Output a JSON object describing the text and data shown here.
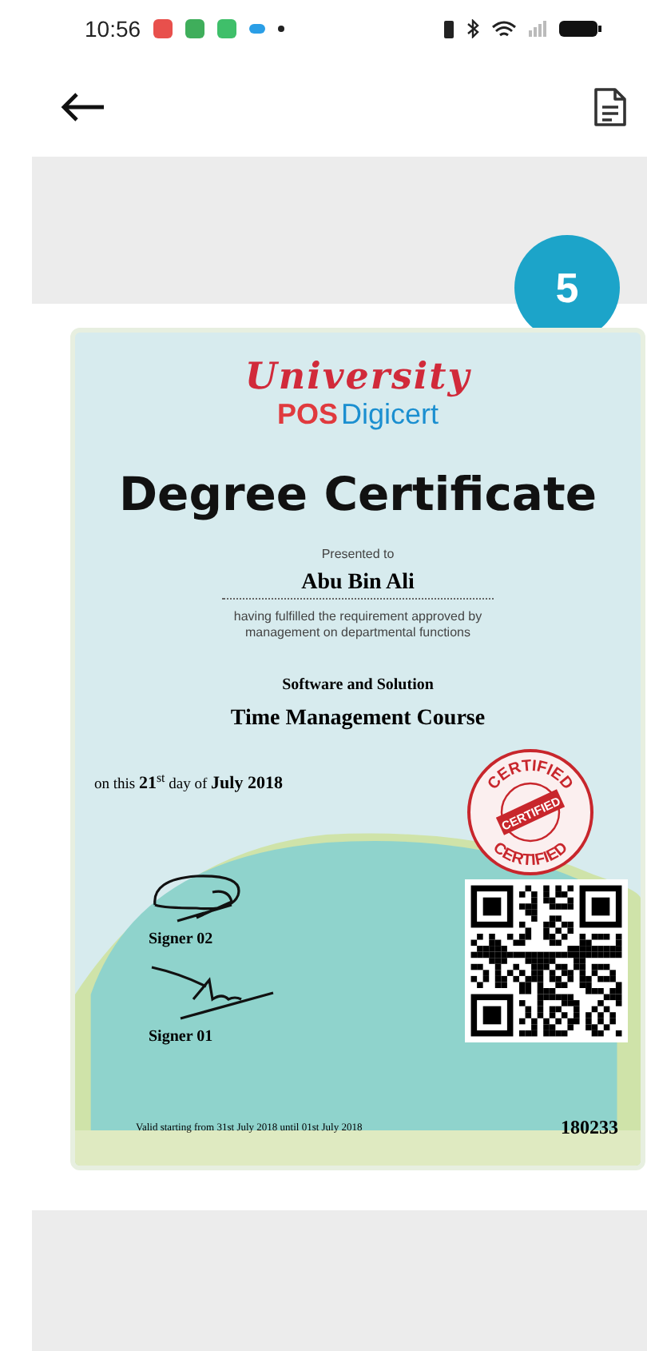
{
  "status_bar": {
    "time": "10:56"
  },
  "certificate": {
    "badge": "5",
    "university": "University",
    "logo_brand": "POS",
    "logo_name": "Digicert",
    "title": "Degree Certificate",
    "presented": "Presented to",
    "recipient": "Abu Bin Ali",
    "statement": "having fulfilled the requirement approved by management on departmental functions",
    "department": "Software and Solution",
    "course": "Time Management Course",
    "date": "on this **21**$^{st}$ day of **July 2018**",
    "stamp": {
      "ring_top": "CERTIFIED",
      "center": "CERTIFIED",
      "ring_bottom": "CERTIFIED"
    },
    "signers": [
      {
        "name": "Signer 02"
      },
      {
        "name": "Signer 01"
      }
    ],
    "validity": "Valid starting from 31st July 2018 until 01st July 2018",
    "serial": "180233"
  }
}
